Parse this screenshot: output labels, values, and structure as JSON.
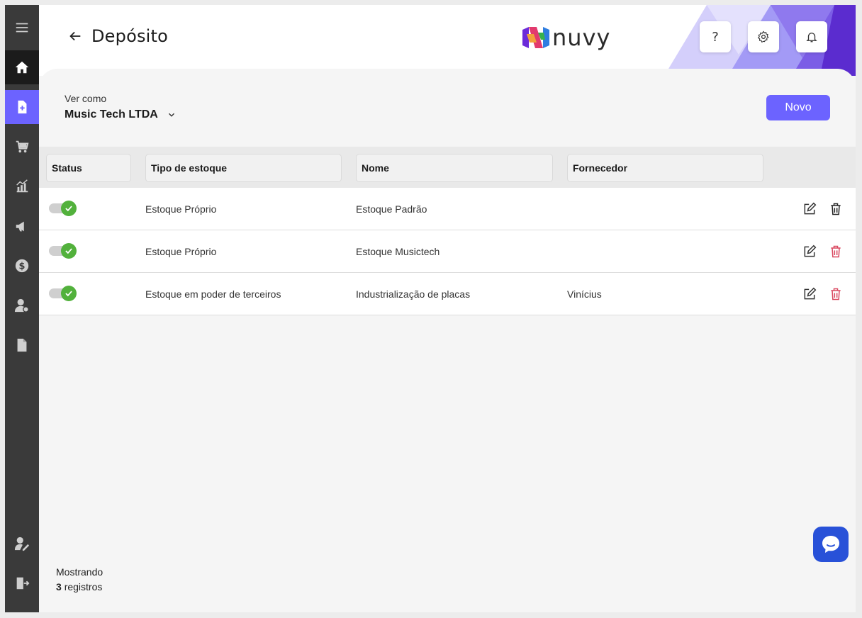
{
  "header": {
    "title": "Depósito",
    "logo_text": "nuvy",
    "help_label": "?"
  },
  "sidebar": {
    "items": [
      {
        "icon": "menu-icon"
      },
      {
        "icon": "home-icon"
      },
      {
        "icon": "document-plus-icon"
      },
      {
        "icon": "cart-icon"
      },
      {
        "icon": "chart-icon"
      },
      {
        "icon": "megaphone-icon"
      },
      {
        "icon": "dollar-icon"
      },
      {
        "icon": "user-money-icon"
      },
      {
        "icon": "file-icon"
      },
      {
        "icon": "user-edit-icon"
      },
      {
        "icon": "logout-icon"
      }
    ]
  },
  "filters": {
    "ver_como_label": "Ver como",
    "ver_como_value": "Music Tech LTDA"
  },
  "actions": {
    "novo_label": "Novo"
  },
  "table": {
    "headers": [
      "Status",
      "Tipo de estoque",
      "Nome",
      "Fornecedor"
    ],
    "rows": [
      {
        "status": "ativo",
        "tipo": "Estoque Próprio",
        "nome": "Estoque Padrão",
        "fornecedor": ""
      },
      {
        "status": "ativo",
        "tipo": "Estoque Próprio",
        "nome": "Estoque Musictech",
        "fornecedor": ""
      },
      {
        "status": "ativo",
        "tipo": "Estoque em poder de terceiros",
        "nome": "Industrialização de placas",
        "fornecedor": "Vinícius"
      }
    ]
  },
  "footer": {
    "showing_label": "Mostrando",
    "count": "3",
    "records_label": "registros"
  },
  "colors": {
    "accent": "#6c63ff",
    "sidebar": "#3a3a3a",
    "toggle_on": "#52b13c",
    "delete_red": "#d9475f",
    "chat": "#2851d8"
  }
}
